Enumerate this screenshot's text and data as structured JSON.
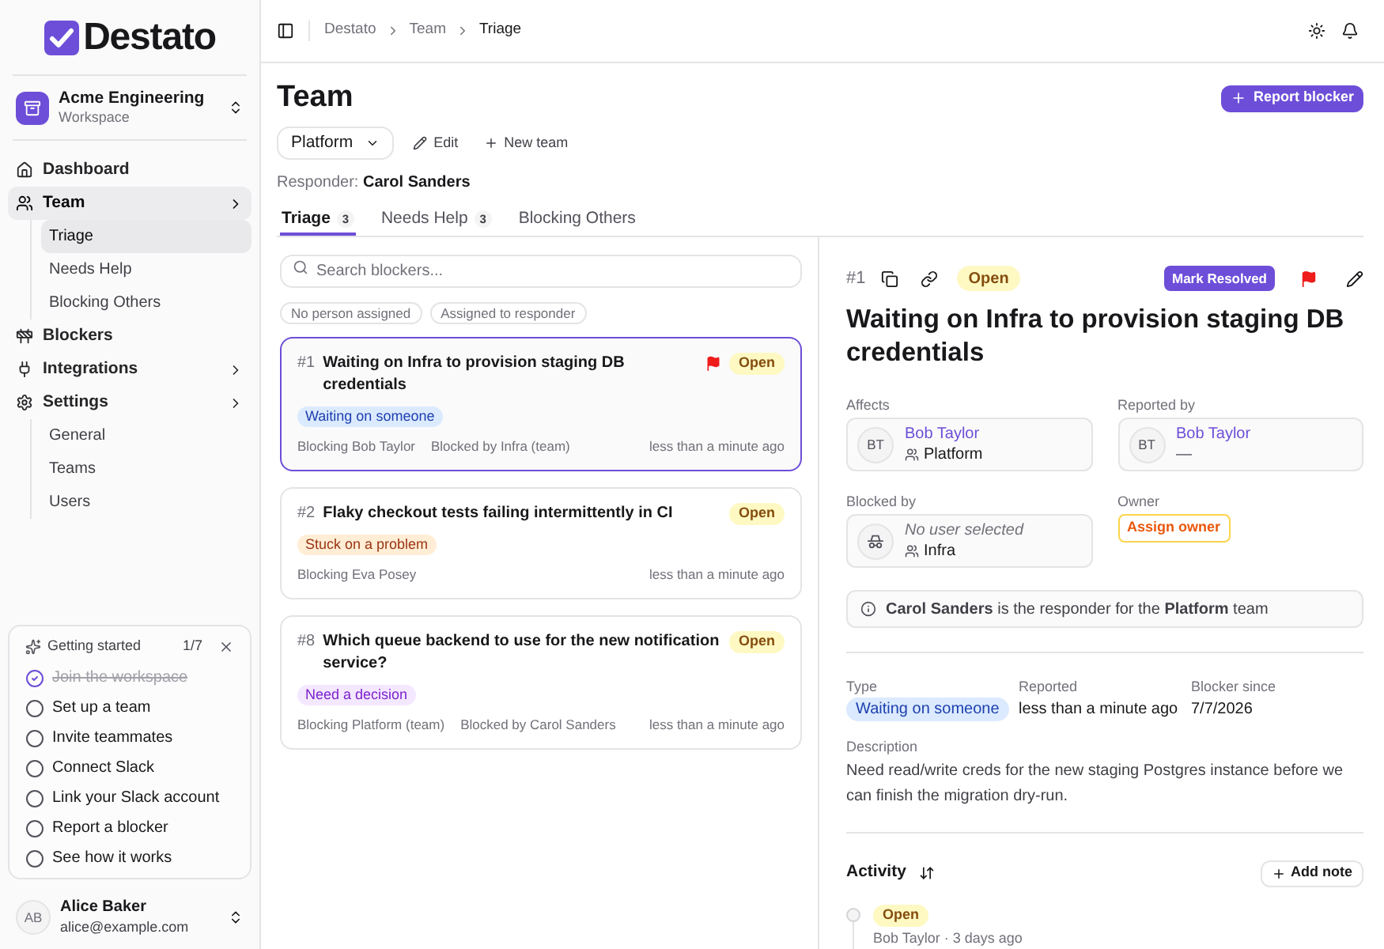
{
  "sidebar": {
    "logo": "Destato",
    "workspace": {
      "name": "Acme Engineering",
      "subtitle": "Workspace"
    },
    "nav": [
      {
        "label": "Dashboard",
        "selected": false,
        "submenu": false
      },
      {
        "label": "Team",
        "selected": true,
        "submenu": true,
        "children": [
          {
            "label": "Triage",
            "selected": true
          },
          {
            "label": "Needs Help",
            "selected": false
          },
          {
            "label": "Blocking Others",
            "selected": false
          }
        ]
      },
      {
        "label": "Blockers",
        "selected": false,
        "submenu": false
      },
      {
        "label": "Integrations",
        "selected": false,
        "submenu": true
      },
      {
        "label": "Settings",
        "selected": false,
        "submenu": true,
        "children": [
          {
            "label": "General",
            "selected": false
          },
          {
            "label": "Teams",
            "selected": false
          },
          {
            "label": "Users",
            "selected": false
          }
        ]
      }
    ],
    "getting_started": {
      "title": "Getting started",
      "progress": "1/7",
      "tasks": [
        {
          "label": "Join the workspace",
          "checked": true
        },
        {
          "label": "Set up a team",
          "checked": false
        },
        {
          "label": "Invite teammates",
          "checked": false
        },
        {
          "label": "Connect Slack",
          "checked": false
        },
        {
          "label": "Link your Slack account",
          "checked": false
        },
        {
          "label": "Report a blocker",
          "checked": false
        },
        {
          "label": "See how it works",
          "checked": false
        }
      ]
    },
    "user": {
      "initials": "AB",
      "name": "Alice Baker",
      "email": "alice@example.com"
    }
  },
  "topbar": {
    "breadcrumb": [
      "Destato",
      "Team",
      "Triage"
    ]
  },
  "header": {
    "title": "Team",
    "primary_button": "Report blocker",
    "team_select": "Platform",
    "actions": [
      "Edit",
      "New team"
    ],
    "responder": "Responder: **Carol Sanders**"
  },
  "tabs": [
    {
      "label": "Triage",
      "count": "3",
      "selected": true
    },
    {
      "label": "Needs Help",
      "count": "3",
      "selected": false
    },
    {
      "label": "Blocking Others",
      "selected": false
    }
  ],
  "list": {
    "search": {
      "placeholder": "Search blockers..."
    },
    "filters": [
      {
        "label": "No person assigned",
        "selected": false
      },
      {
        "label": "Assigned to responder",
        "selected": false
      }
    ],
    "items": [
      {
        "number": "#1",
        "title": "Waiting on Infra to provision staging DB credentials",
        "flagged": true,
        "status": "Open",
        "type": {
          "label": "Waiting on someone",
          "kind": "waiting"
        },
        "blocking": "Blocking Bob Taylor",
        "blocked_by": "Blocked by Infra (team)",
        "time": "less than a minute ago",
        "selected": true
      },
      {
        "number": "#2",
        "title": "Flaky checkout tests failing intermittently in CI",
        "flagged": false,
        "status": "Open",
        "type": {
          "label": "Stuck on a problem",
          "kind": "stuck"
        },
        "blocking": "Blocking Eva Posey",
        "time": "less than a minute ago",
        "selected": false
      },
      {
        "number": "#8",
        "title": "Which queue backend to use for the new notification service?",
        "flagged": false,
        "status": "Open",
        "type": {
          "label": "Need a decision",
          "kind": "decision"
        },
        "blocking": "Blocking Platform (team)",
        "blocked_by": "Blocked by Carol Sanders",
        "time": "less than a minute ago",
        "selected": false
      }
    ]
  },
  "detail": {
    "number": "#1",
    "status": "Open",
    "primary_action": "Mark Resolved",
    "flagged": true,
    "title": "Waiting on Infra to provision staging DB credentials",
    "people": [
      {
        "label": "Affects",
        "kind": "user",
        "initials": "BT",
        "name": "Bob Taylor",
        "team": "Platform"
      },
      {
        "label": "Reported by",
        "kind": "user",
        "initials": "BT",
        "name": "Bob Taylor",
        "note": "—"
      },
      {
        "label": "Blocked by",
        "kind": "empty",
        "name": "No user selected",
        "team": "Infra"
      }
    ],
    "owner": {
      "label": "Owner",
      "button": "Assign owner"
    },
    "notice": "**Carol Sanders** is the responder for the **Platform** team",
    "fields": [
      {
        "label": "Type",
        "badge": {
          "label": "Waiting on someone",
          "kind": "waiting"
        }
      },
      {
        "label": "Reported",
        "value": "less than a minute ago"
      },
      {
        "label": "Blocker since",
        "value": "7/7/2026"
      }
    ],
    "description": {
      "label": "Description",
      "text": "Need read/write creds for the new staging Postgres instance before we can finish the migration dry-run."
    },
    "activity": {
      "title": "Activity",
      "button": "Add note",
      "entries": [
        {
          "status": "Open",
          "meta": "Bob Taylor · 3 days ago"
        }
      ]
    }
  }
}
